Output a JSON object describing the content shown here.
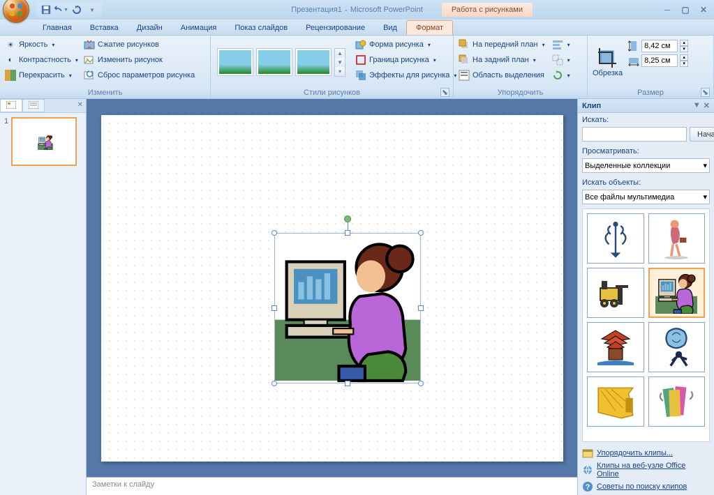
{
  "title": {
    "doc": "Презентация1",
    "app": "Microsoft PowerPoint",
    "contextual": "Работа с рисунками"
  },
  "tabs": [
    "Главная",
    "Вставка",
    "Дизайн",
    "Анимация",
    "Показ слайдов",
    "Рецензирование",
    "Вид",
    "Формат"
  ],
  "active_tab": "Формат",
  "ribbon": {
    "adjust": {
      "label": "Изменить",
      "brightness": "Яркость",
      "contrast": "Контрастность",
      "recolor": "Перекрасить",
      "compress": "Сжатие рисунков",
      "change": "Изменить рисунок",
      "reset": "Сброс параметров рисунка"
    },
    "styles": {
      "label": "Стили рисунков",
      "shape": "Форма рисунка",
      "border": "Граница рисунка",
      "effects": "Эффекты для рисунка"
    },
    "arrange": {
      "label": "Упорядочить",
      "front": "На передний план",
      "back": "На задний план",
      "selpane": "Область выделения"
    },
    "size": {
      "label": "Размер",
      "crop": "Обрезка",
      "h": "8,42 см",
      "w": "8,25 см"
    }
  },
  "thumbnails": {
    "slide_num": "1"
  },
  "notes_placeholder": "Заметки к слайду",
  "clip": {
    "title": "Клип",
    "search_label": "Искать:",
    "search_btn": "Начать",
    "view_label": "Просматривать:",
    "view_value": "Выделенные коллекции",
    "objects_label": "Искать объекты:",
    "objects_value": "Все файлы мультимедиа",
    "link1": "Упорядочить клипы...",
    "link2": "Клипы на веб-узле Office Online",
    "link3": "Советы по поиску клипов"
  }
}
